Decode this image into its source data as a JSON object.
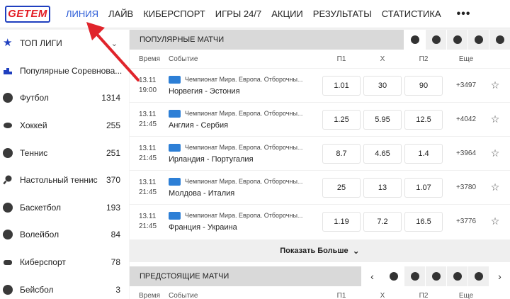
{
  "logo": {
    "text": "GETEM"
  },
  "nav": {
    "items": [
      "ЛИНИЯ",
      "ЛАЙВ",
      "КИБЕРСПОРТ",
      "ИГРЫ 24/7",
      "АКЦИИ",
      "РЕЗУЛЬТАТЫ",
      "СТАТИСТИКА"
    ],
    "more": "•••"
  },
  "sidebar": {
    "items": [
      {
        "label": "ТОП ЛИГИ",
        "count": "",
        "icon": "star-icon"
      },
      {
        "label": "Популярные Соревнова...",
        "count": "",
        "icon": "podium-icon"
      },
      {
        "label": "Футбол",
        "count": "1314",
        "icon": "football-icon"
      },
      {
        "label": "Хоккей",
        "count": "255",
        "icon": "hockey-puck-icon"
      },
      {
        "label": "Теннис",
        "count": "251",
        "icon": "tennis-ball-icon"
      },
      {
        "label": "Настольный теннис",
        "count": "370",
        "icon": "table-tennis-icon"
      },
      {
        "label": "Баскетбол",
        "count": "193",
        "icon": "basketball-icon"
      },
      {
        "label": "Волейбол",
        "count": "84",
        "icon": "volleyball-icon"
      },
      {
        "label": "Киберспорт",
        "count": "78",
        "icon": "gamepad-icon"
      },
      {
        "label": "Бейсбол",
        "count": "3",
        "icon": "baseball-icon"
      }
    ]
  },
  "popular": {
    "title": "ПОПУЛЯРНЫЕ МАТЧИ",
    "columns": {
      "time": "Время",
      "event": "Событие",
      "p1": "П1",
      "x": "Х",
      "p2": "П2",
      "more": "Еще"
    },
    "matches": [
      {
        "date": "13.11",
        "time": "19:00",
        "league": "Чемпионат Мира. Европа. Отборочны...",
        "home": "Норвегия",
        "away": "Эстония",
        "p1": "1.01",
        "x": "30",
        "p2": "90",
        "more": "+3497"
      },
      {
        "date": "13.11",
        "time": "21:45",
        "league": "Чемпионат Мира. Европа. Отборочны...",
        "home": "Англия",
        "away": "Сербия",
        "p1": "1.25",
        "x": "5.95",
        "p2": "12.5",
        "more": "+4042"
      },
      {
        "date": "13.11",
        "time": "21:45",
        "league": "Чемпионат Мира. Европа. Отборочны...",
        "home": "Ирландия",
        "away": "Португалия",
        "p1": "8.7",
        "x": "4.65",
        "p2": "1.4",
        "more": "+3964"
      },
      {
        "date": "13.11",
        "time": "21:45",
        "league": "Чемпионат Мира. Европа. Отборочны...",
        "home": "Молдова",
        "away": "Италия",
        "p1": "25",
        "x": "13",
        "p2": "1.07",
        "more": "+3780"
      },
      {
        "date": "13.11",
        "time": "21:45",
        "league": "Чемпионат Мира. Европа. Отборочны...",
        "home": "Франция",
        "away": "Украина",
        "p1": "1.19",
        "x": "7.2",
        "p2": "16.5",
        "more": "+3776"
      }
    ],
    "show_more": "Показать Больше"
  },
  "upcoming": {
    "title": "ПРЕДСТОЯЩИЕ МАТЧИ",
    "columns": {
      "time": "Время",
      "event": "Событие",
      "p1": "П1",
      "x": "Х",
      "p2": "П2",
      "more": "Еще"
    }
  },
  "colors": {
    "accent": "#2a5bd7",
    "brand_red": "#e31b23",
    "flag": "#2d7fd6",
    "annotation_arrow": "#e0242b"
  }
}
